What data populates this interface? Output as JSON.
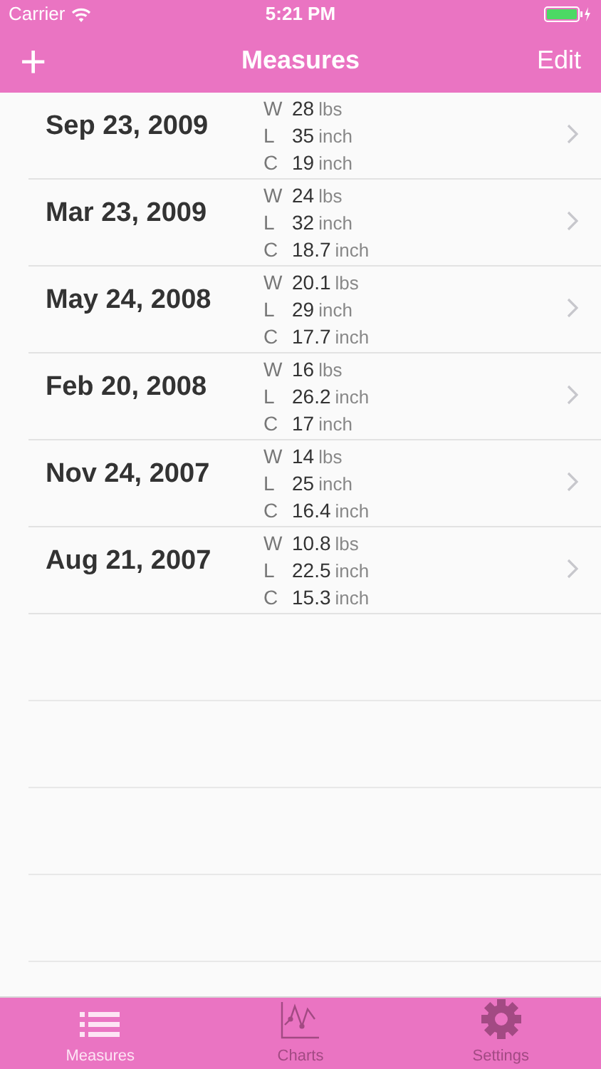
{
  "status_bar": {
    "carrier": "Carrier",
    "time": "5:21 PM"
  },
  "nav_bar": {
    "add": "+",
    "title": "Measures",
    "edit": "Edit"
  },
  "entries": [
    {
      "date": "Sep 23, 2009",
      "measures": [
        {
          "label": "W",
          "value": "28",
          "unit": "lbs"
        },
        {
          "label": "L",
          "value": "35",
          "unit": "inch"
        },
        {
          "label": "C",
          "value": "19",
          "unit": "inch"
        }
      ]
    },
    {
      "date": "Mar 23, 2009",
      "measures": [
        {
          "label": "W",
          "value": "24",
          "unit": "lbs"
        },
        {
          "label": "L",
          "value": "32",
          "unit": "inch"
        },
        {
          "label": "C",
          "value": "18.7",
          "unit": "inch"
        }
      ]
    },
    {
      "date": "May 24, 2008",
      "measures": [
        {
          "label": "W",
          "value": "20.1",
          "unit": "lbs"
        },
        {
          "label": "L",
          "value": "29",
          "unit": "inch"
        },
        {
          "label": "C",
          "value": "17.7",
          "unit": "inch"
        }
      ]
    },
    {
      "date": "Feb 20, 2008",
      "measures": [
        {
          "label": "W",
          "value": "16",
          "unit": "lbs"
        },
        {
          "label": "L",
          "value": "26.2",
          "unit": "inch"
        },
        {
          "label": "C",
          "value": "17",
          "unit": "inch"
        }
      ]
    },
    {
      "date": "Nov 24, 2007",
      "measures": [
        {
          "label": "W",
          "value": "14",
          "unit": "lbs"
        },
        {
          "label": "L",
          "value": "25",
          "unit": "inch"
        },
        {
          "label": "C",
          "value": "16.4",
          "unit": "inch"
        }
      ]
    },
    {
      "date": "Aug 21, 2007",
      "measures": [
        {
          "label": "W",
          "value": "10.8",
          "unit": "lbs"
        },
        {
          "label": "L",
          "value": "22.5",
          "unit": "inch"
        },
        {
          "label": "C",
          "value": "15.3",
          "unit": "inch"
        }
      ]
    }
  ],
  "tabs": [
    {
      "kind": "list",
      "label": "Measures",
      "selected": true
    },
    {
      "kind": "chart",
      "label": "Charts",
      "selected": false
    },
    {
      "kind": "gear",
      "label": "Settings",
      "selected": false
    }
  ]
}
